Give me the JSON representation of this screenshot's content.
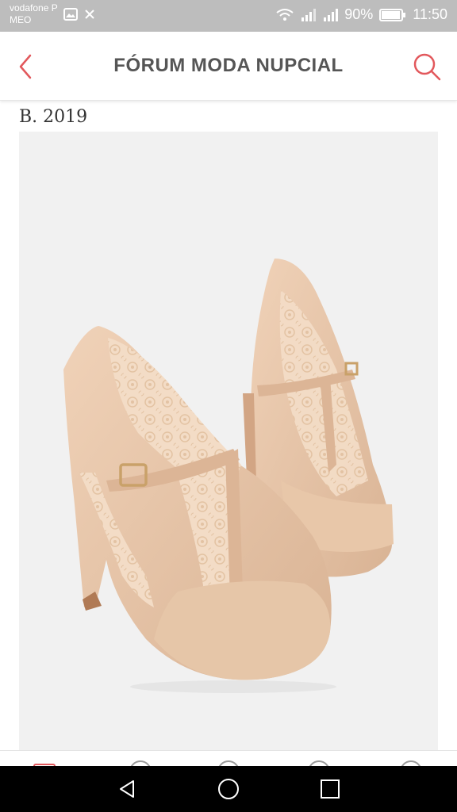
{
  "status_bar": {
    "carrier_line1": "vodafone P",
    "carrier_line2": "MEO",
    "battery": "90%",
    "time": "11:50"
  },
  "header": {
    "title": "FÓRUM MODA NUPCIAL",
    "back_icon": "chevron-left-icon",
    "search_icon": "search-icon",
    "accent_color": "#e2585c"
  },
  "post": {
    "caption": "B. 2019",
    "image_subject": "beige suede T-strap platform heels with lace panels"
  },
  "nav_bar": {
    "back_icon": "triangle-back-icon",
    "home_icon": "circle-home-icon",
    "recents_icon": "square-recents-icon"
  }
}
